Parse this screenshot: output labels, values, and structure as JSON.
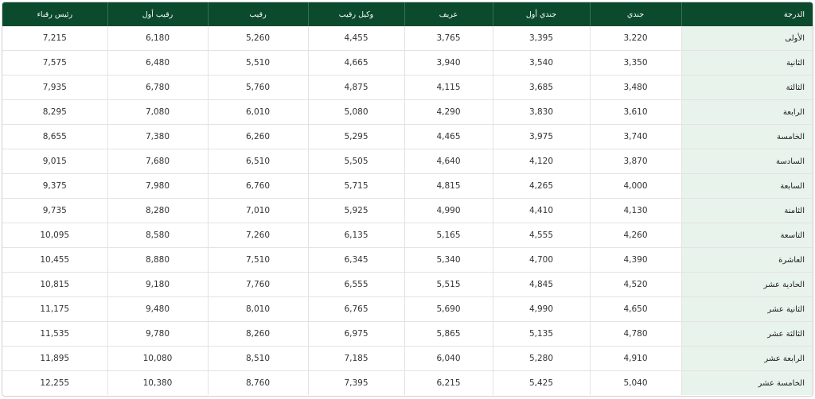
{
  "table": {
    "headers": [
      "الدرجة",
      "جندي",
      "جندي أول",
      "عريف",
      "وكيل رقيب",
      "رقيب",
      "رقيب أول",
      "رئيس رقباء"
    ],
    "rows": [
      [
        "الأولى",
        "3,220",
        "3,395",
        "3,765",
        "4,455",
        "5,260",
        "6,180",
        "7,215"
      ],
      [
        "الثانية",
        "3,350",
        "3,540",
        "3,940",
        "4,665",
        "5,510",
        "6,480",
        "7,575"
      ],
      [
        "الثالثة",
        "3,480",
        "3,685",
        "4,115",
        "4,875",
        "5,760",
        "6,780",
        "7,935"
      ],
      [
        "الرابعة",
        "3,610",
        "3,830",
        "4,290",
        "5,080",
        "6,010",
        "7,080",
        "8,295"
      ],
      [
        "الخامسة",
        "3,740",
        "3,975",
        "4,465",
        "5,295",
        "6,260",
        "7,380",
        "8,655"
      ],
      [
        "السادسة",
        "3,870",
        "4,120",
        "4,640",
        "5,505",
        "6,510",
        "7,680",
        "9,015"
      ],
      [
        "السابعة",
        "4,000",
        "4,265",
        "4,815",
        "5,715",
        "6,760",
        "7,980",
        "9,375"
      ],
      [
        "الثامنة",
        "4,130",
        "4,410",
        "4,990",
        "5,925",
        "7,010",
        "8,280",
        "9,735"
      ],
      [
        "التاسعة",
        "4,260",
        "4,555",
        "5,165",
        "6,135",
        "7,260",
        "8,580",
        "10,095"
      ],
      [
        "العاشرة",
        "4,390",
        "4,700",
        "5,340",
        "6,345",
        "7,510",
        "8,880",
        "10,455"
      ],
      [
        "الحادية عشر",
        "4,520",
        "4,845",
        "5,515",
        "6,555",
        "7,760",
        "9,180",
        "10,815"
      ],
      [
        "الثانية عشر",
        "4,650",
        "4,990",
        "5,690",
        "6,765",
        "8,010",
        "9,480",
        "11,175"
      ],
      [
        "الثالثة عشر",
        "4,780",
        "5,135",
        "5,865",
        "6,975",
        "8,260",
        "9,780",
        "11,535"
      ],
      [
        "الرابعة عشر",
        "4,910",
        "5,280",
        "6,040",
        "7,185",
        "8,510",
        "10,080",
        "11,895"
      ],
      [
        "الخامسة عشر",
        "5,040",
        "5,425",
        "6,215",
        "7,395",
        "8,760",
        "10,380",
        "12,255"
      ]
    ]
  },
  "colors": {
    "header_bg": "#0b4a2c",
    "grade_column_bg": "#e8f3ec"
  }
}
